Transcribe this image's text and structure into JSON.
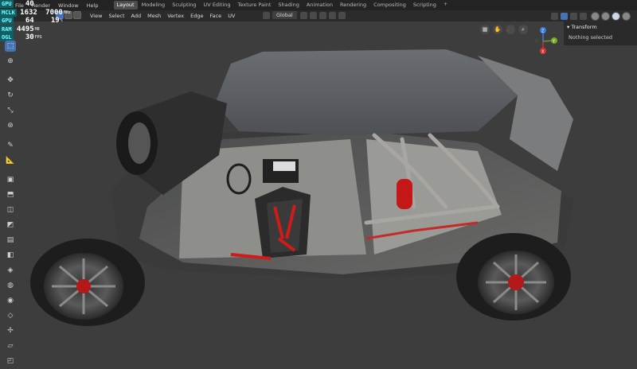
{
  "stats": [
    {
      "label": "GPU",
      "v1": "40",
      "v2": ""
    },
    {
      "label": "MCLK",
      "v1": "1632",
      "v2": "7000",
      "unit": "MHz"
    },
    {
      "label": "GPU",
      "v1": "64",
      "v2": "19",
      "unit": "%"
    },
    {
      "label": "RAM",
      "v1": "4495",
      "v2": "",
      "unit": "MB"
    },
    {
      "label": "OGL",
      "v1": "30",
      "v2": "",
      "unit": "FPS"
    }
  ],
  "menubar": {
    "items": [
      "File",
      "Render",
      "Window",
      "Help"
    ],
    "tabs": [
      "Layout",
      "Modeling",
      "Sculpting",
      "UV Editing",
      "Texture Paint",
      "Shading",
      "Animation",
      "Rendering",
      "Compositing",
      "Scripting"
    ],
    "active_tab": "Layout"
  },
  "header": {
    "menus": [
      "View",
      "Select",
      "Add",
      "Mesh",
      "Vertex",
      "Edge",
      "Face",
      "UV"
    ],
    "orientation": "Global"
  },
  "sidebar": {
    "title": "Transform",
    "body": "Nothing selected"
  },
  "gizmo": {
    "z": "Z",
    "y": "Y",
    "x": "X"
  },
  "colors": {
    "accent": "#4772b3",
    "panel": "#2a2a2a",
    "viewport": "#3d3d3d"
  }
}
